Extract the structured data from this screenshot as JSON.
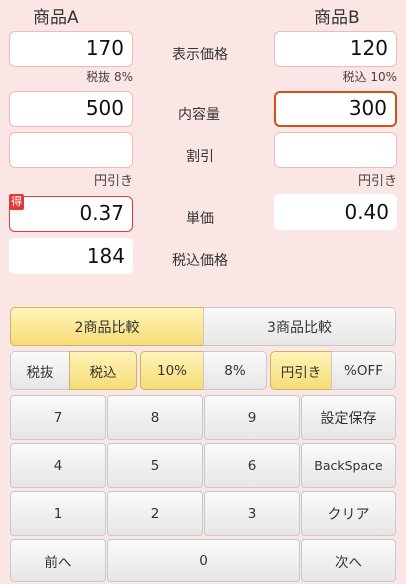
{
  "headers": {
    "product_a": "商品A",
    "product_b": "商品B"
  },
  "rows": {
    "display_price": "表示価格",
    "content": "内容量",
    "discount": "割引",
    "unit_price": "単価",
    "tax_included_price": "税込価格"
  },
  "product_a": {
    "display_price": "170",
    "tax_note": "税抜 8%",
    "content": "500",
    "discount": "",
    "discount_mode": "円引き",
    "unit_price": "0.37",
    "best_badge": "得",
    "tax_included_price": "184"
  },
  "product_b": {
    "display_price": "120",
    "tax_note": "税込 10%",
    "content": "300",
    "discount": "",
    "discount_mode": "円引き",
    "unit_price": "0.40"
  },
  "tabs": {
    "two": "2商品比較",
    "three": "3商品比較",
    "active": "two"
  },
  "options": {
    "tax_excluded": "税抜",
    "tax_included": "税込",
    "rate_10": "10%",
    "rate_8": "8%",
    "yen_off": "円引き",
    "percent_off": "%OFF"
  },
  "keypad": {
    "k7": "7",
    "k8": "8",
    "k9": "9",
    "save": "設定保存",
    "k4": "4",
    "k5": "5",
    "k6": "6",
    "backspace": "BackSpace",
    "k1": "1",
    "k2": "2",
    "k3": "3",
    "clear": "クリア",
    "prev": "前へ",
    "k0": "0",
    "next": "次へ"
  },
  "colors": {
    "background": "#fbe6e6",
    "highlight": "#f6dc77",
    "focus": "#d0501a",
    "best": "#e53939"
  }
}
